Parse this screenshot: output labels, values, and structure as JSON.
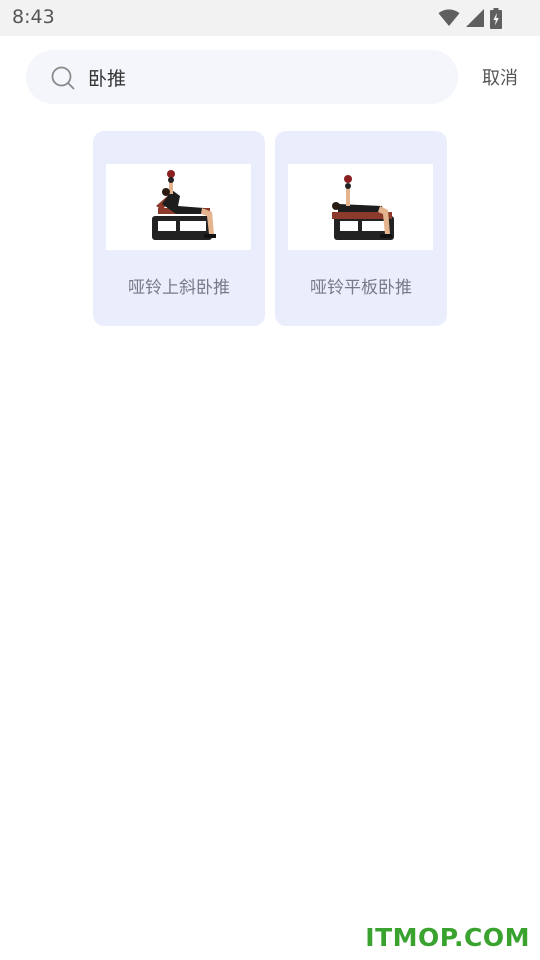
{
  "status_bar": {
    "time": "8:43",
    "icons": [
      "wifi-icon",
      "cell-signal-icon",
      "battery-charging-icon"
    ]
  },
  "search": {
    "query": "卧推",
    "icon": "search-icon",
    "cancel_label": "取消"
  },
  "results": [
    {
      "title": "哑铃上斜卧推",
      "image": "incline-dumbbell-press-illustration"
    },
    {
      "title": "哑铃平板卧推",
      "image": "flat-dumbbell-press-illustration"
    }
  ],
  "watermark": "ITMOP.COM",
  "colors": {
    "status_bg": "#f2f2f2",
    "search_bg": "#f4f6fb",
    "card_bg": "#eaeefc",
    "label_text": "#7a7a86",
    "watermark": "#3aa32f"
  }
}
